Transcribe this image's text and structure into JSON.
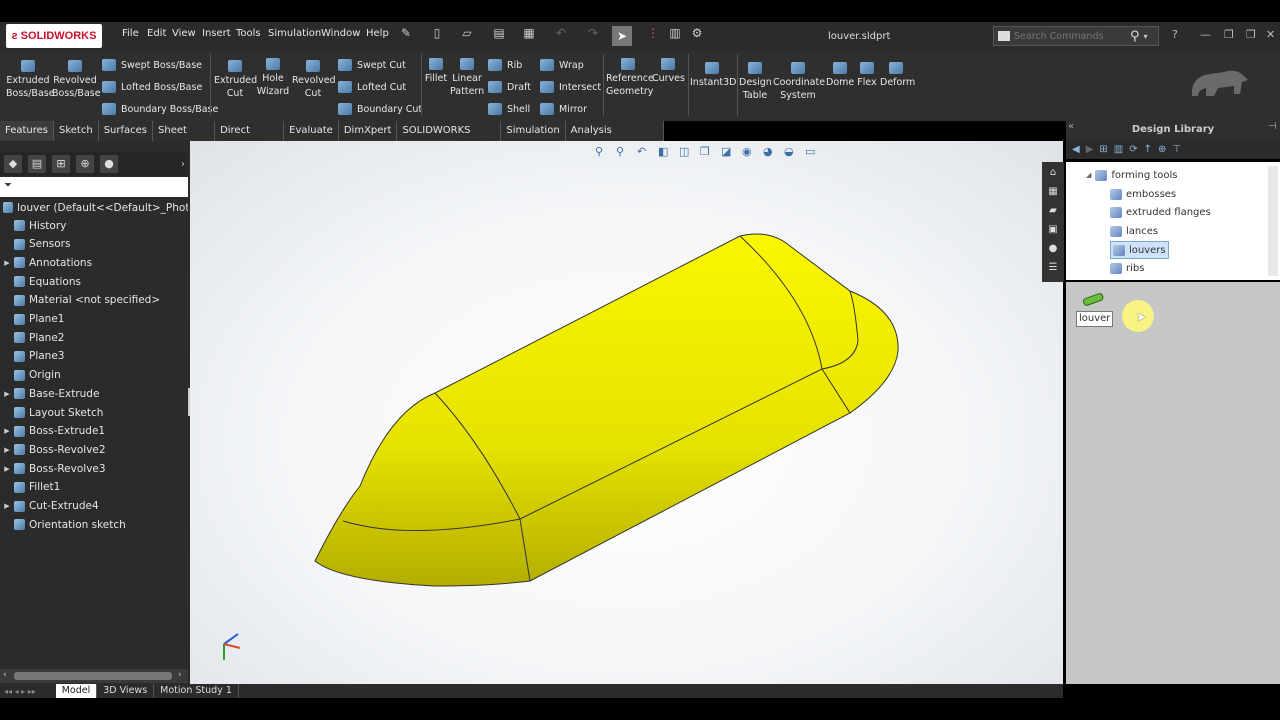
{
  "app": {
    "logo_text": "SOLIDWORKS",
    "file_name": "louver.sldprt"
  },
  "menu": [
    "File",
    "Edit",
    "View",
    "Insert",
    "Tools",
    "Simulation",
    "Window",
    "Help"
  ],
  "search": {
    "placeholder": "Search Commands"
  },
  "ribbon": {
    "extruded_boss": "Extruded\nBoss/Base",
    "revolved_boss": "Revolved\nBoss/Base",
    "swept_boss": "Swept Boss/Base",
    "lofted_boss": "Lofted Boss/Base",
    "boundary_boss": "Boundary Boss/Base",
    "extruded_cut": "Extruded\nCut",
    "hole_wizard": "Hole\nWizard",
    "revolved_cut": "Revolved\nCut",
    "swept_cut": "Swept Cut",
    "lofted_cut": "Lofted Cut",
    "boundary_cut": "Boundary Cut",
    "fillet": "Fillet",
    "linear_pattern": "Linear\nPattern",
    "rib": "Rib",
    "draft": "Draft",
    "shell": "Shell",
    "wrap": "Wrap",
    "intersect": "Intersect",
    "mirror": "Mirror",
    "reference_geometry": "Reference\nGeometry",
    "curves": "Curves",
    "instant3d": "Instant3D",
    "design_table": "Design\nTable",
    "coordinate_system": "Coordinate\nSystem",
    "dome": "Dome",
    "flex": "Flex",
    "deform": "Deform"
  },
  "tabs": [
    "Features",
    "Sketch",
    "Surfaces",
    "Sheet Metal",
    "Direct Editing",
    "Evaluate",
    "DimXpert",
    "SOLIDWORKS Add-Ins",
    "Simulation",
    "Analysis Preparation"
  ],
  "tree": {
    "root": "louver  (Default<<Default>_PhotoV",
    "items": [
      {
        "label": "History",
        "arrow": false
      },
      {
        "label": "Sensors",
        "arrow": false
      },
      {
        "label": "Annotations",
        "arrow": true
      },
      {
        "label": "Equations",
        "arrow": false
      },
      {
        "label": "Material <not specified>",
        "arrow": false
      },
      {
        "label": "Plane1",
        "arrow": false
      },
      {
        "label": "Plane2",
        "arrow": false
      },
      {
        "label": "Plane3",
        "arrow": false
      },
      {
        "label": "Origin",
        "arrow": false
      },
      {
        "label": "Base-Extrude",
        "arrow": true
      },
      {
        "label": "Layout Sketch",
        "arrow": false
      },
      {
        "label": "Boss-Extrude1",
        "arrow": true
      },
      {
        "label": "Boss-Revolve2",
        "arrow": true
      },
      {
        "label": "Boss-Revolve3",
        "arrow": true
      },
      {
        "label": "Fillet1",
        "arrow": false
      },
      {
        "label": "Cut-Extrude4",
        "arrow": true
      },
      {
        "label": "Orientation sketch",
        "arrow": false
      }
    ]
  },
  "design_library": {
    "title": "Design Library",
    "folder": "forming tools",
    "items": [
      "embosses",
      "extruded flanges",
      "lances",
      "louvers",
      "ribs"
    ],
    "selected": "louvers",
    "file": "louver"
  },
  "bottom_tabs": [
    "Model",
    "3D Views",
    "Motion Study 1"
  ],
  "colors": {
    "part": "#f2ee00",
    "accent": "#4a7aa8"
  }
}
